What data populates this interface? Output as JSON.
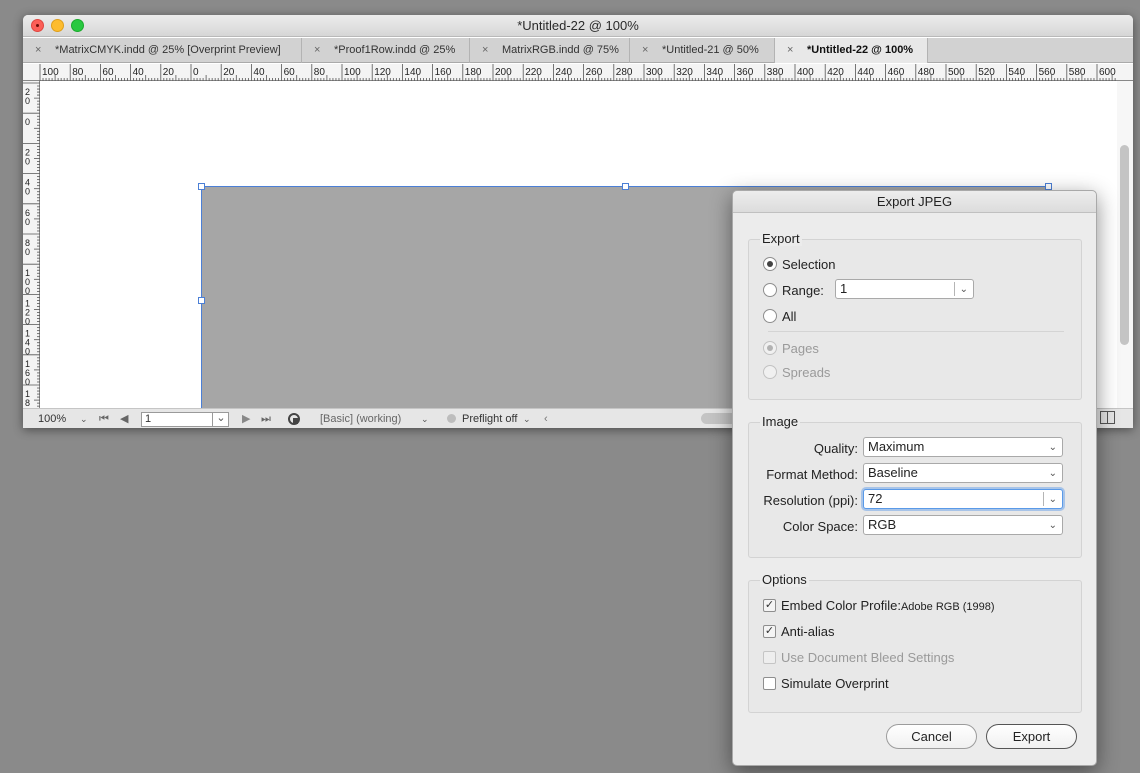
{
  "window": {
    "title": "*Untitled-22 @ 100%",
    "tabs": [
      {
        "label": "*MatrixCMYK.indd @ 25% [Overprint Preview]",
        "active": false
      },
      {
        "label": "*Proof1Row.indd @ 25%",
        "active": false
      },
      {
        "label": "MatrixRGB.indd @ 75%",
        "active": false
      },
      {
        "label": "*Untitled-21 @ 50%",
        "active": false
      },
      {
        "label": "*Untitled-22 @ 100%",
        "active": true
      }
    ],
    "tab_close_glyph": "×"
  },
  "rulers": {
    "horizontal_labels": [
      "100",
      "80",
      "60",
      "40",
      "20",
      "0",
      "20",
      "40",
      "60",
      "80",
      "100",
      "120",
      "140",
      "160",
      "180",
      "200",
      "220",
      "240",
      "260",
      "280",
      "300",
      "320",
      "340",
      "360",
      "380",
      "400",
      "420",
      "440",
      "460",
      "480",
      "500",
      "520",
      "540",
      "560",
      "580",
      "600"
    ],
    "vertical_labels": [
      "20",
      "0",
      "20",
      "40",
      "60",
      "80",
      "100",
      "120",
      "140",
      "160",
      "18"
    ]
  },
  "statusbar": {
    "zoom": "100%",
    "page": "1",
    "style": "[Basic] (working)",
    "preflight": "Preflight off"
  },
  "dialog": {
    "title": "Export JPEG",
    "export_group": {
      "label": "Export",
      "selection": "Selection",
      "range": "Range:",
      "range_value": "1",
      "all": "All",
      "pages": "Pages",
      "spreads": "Spreads"
    },
    "image_group": {
      "label": "Image",
      "quality_label": "Quality:",
      "quality_value": "Maximum",
      "format_label": "Format Method:",
      "format_value": "Baseline",
      "resolution_label": "Resolution (ppi):",
      "resolution_value": "72",
      "colorspace_label": "Color Space:",
      "colorspace_value": "RGB"
    },
    "options_group": {
      "label": "Options",
      "embed_profile": "Embed Color Profile:",
      "profile_name": "Adobe RGB (1998)",
      "anti_alias": "Anti-alias",
      "bleed": "Use Document Bleed Settings",
      "overprint": "Simulate Overprint"
    },
    "cancel": "Cancel",
    "export": "Export"
  },
  "colors": {
    "selection_blue": "#4b7fd6",
    "frame_fill": "#a6a6a6",
    "focus_ring": "#5a9ae8"
  },
  "icons": [
    "close-icon",
    "chevron-down-icon",
    "first-page-icon",
    "prev-page-icon",
    "next-page-icon",
    "last-page-icon",
    "preflight-status-icon",
    "collapse-arrow-icon",
    "split-view-icon",
    "checkmark-icon"
  ]
}
